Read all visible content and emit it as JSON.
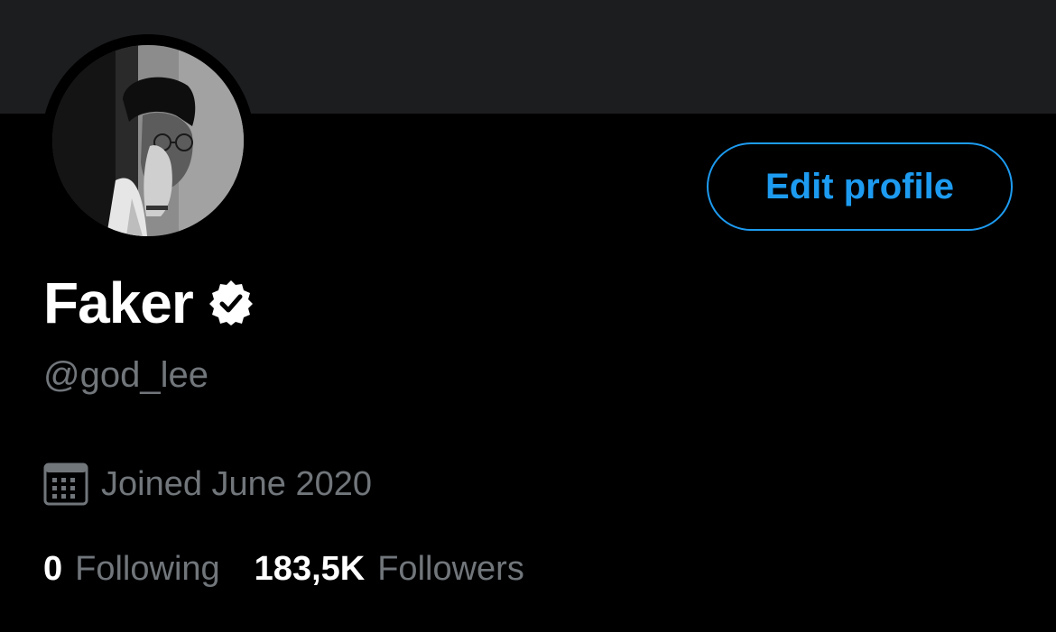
{
  "theme": {
    "background": "#000000",
    "banner": "#1c1d1f",
    "accent": "#1d9bf0",
    "secondary_text": "#71767b",
    "primary_text": "#ffffff"
  },
  "profile": {
    "display_name": "Faker",
    "verified": true,
    "handle": "@god_lee",
    "joined": "Joined June 2020",
    "avatar_icon": "profile-photo",
    "verified_icon": "verified-badge-icon",
    "calendar_icon": "calendar-icon"
  },
  "actions": {
    "edit_profile_label": "Edit profile"
  },
  "stats": {
    "following_count": "0",
    "following_label": "Following",
    "followers_count": "183,5K",
    "followers_label": "Followers"
  }
}
